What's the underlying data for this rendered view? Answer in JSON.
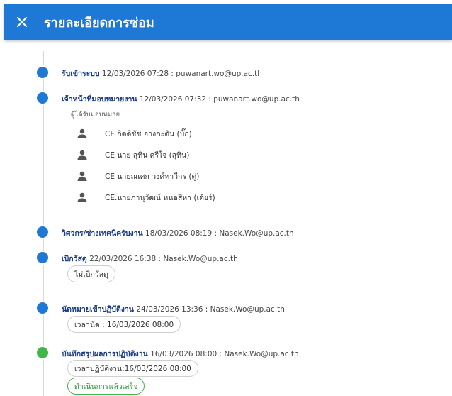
{
  "header": {
    "title": "รายละเอียดการซ่อม",
    "close_icon": "close-icon"
  },
  "colors": {
    "primary": "#1e78d6",
    "success": "#43b649"
  },
  "events": [
    {
      "label": "รับเข้าระบบ",
      "detail": "12/03/2026 07:28 : puwanart.wo@up.ac.th"
    },
    {
      "label": "เจ้าหน้าที่มอบหมายงาน",
      "detail": "12/03/2026 07:32 : puwanart.wo@up.ac.th",
      "sublabel": "ผู้ได้รับมอบหมาย",
      "assignees": [
        "CE กิตติชัช อางกะตัน (บิ๊ก)",
        "CE นาย สุทิน ศรีใจ (สุทิน)",
        "CE นายณเศก วงค์ทาวีกร (ตู่)",
        "CE.นายภานุวัฒน์ หนอสีหา (เต้ยร์)"
      ]
    },
    {
      "label": "วิศวกร/ช่างเทคนิครับงาน",
      "detail": "18/03/2026 08:19 : Nasek.Wo@up.ac.th"
    },
    {
      "label": "เบิกวัสดุ",
      "detail": "22/03/2026 16:38 : Nasek.Wo@up.ac.th",
      "chip": "ไม่เบิกวัสดุ"
    },
    {
      "label": "นัดหมายเข้าปฏิบัติงาน",
      "detail": "24/03/2026 13:36 : Nasek.Wo@up.ac.th",
      "chip": "เวลานัด : 16/03/2026 08:00"
    },
    {
      "label": "บันทึกสรุปผลการปฏิบัติงาน",
      "detail": "16/03/2026 08:00 : Nasek.Wo@up.ac.th",
      "chip": "เวลาปฏิบัติงาน:16/03/2026 08:00",
      "status": "ดำเนินการแล้วเสร็จ"
    }
  ]
}
